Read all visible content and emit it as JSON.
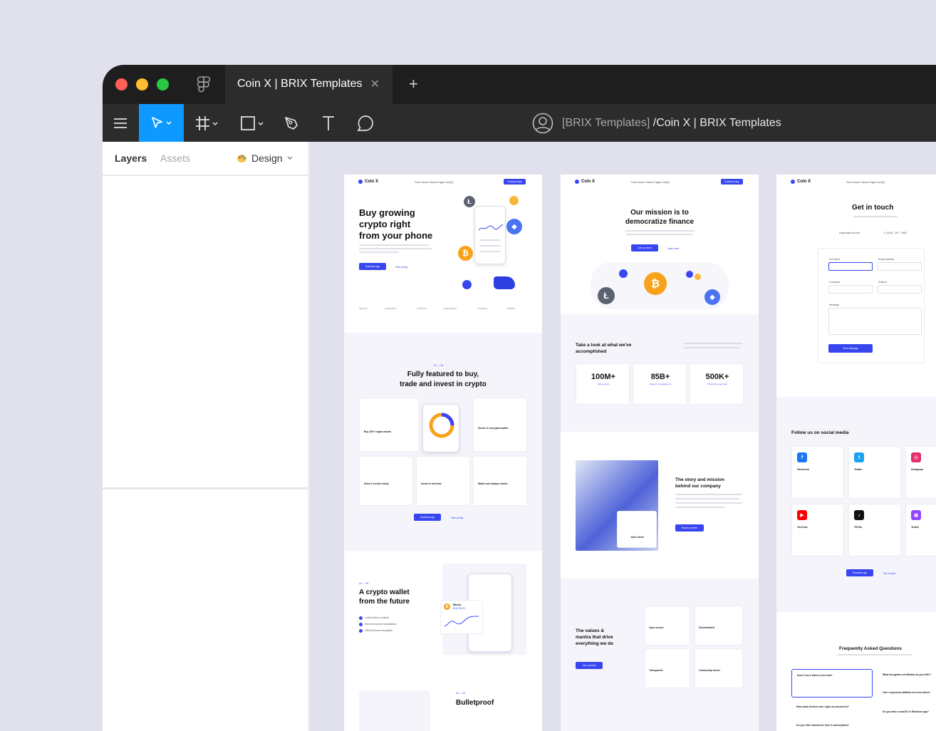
{
  "window": {
    "tab_title": "Coin X | BRIX Templates",
    "tab_close": "✕",
    "new_tab": "+",
    "breadcrumb_team": "[BRIX Templates]",
    "breadcrumb_file": " /Coin X | BRIX Templates"
  },
  "toolbar": {
    "tools": [
      "menu-icon",
      "move-tool-icon",
      "frame-tool-icon",
      "shape-tool-icon",
      "pen-tool-icon",
      "text-tool-icon",
      "comment-tool-icon"
    ]
  },
  "panel": {
    "tab_layers": "Layers",
    "tab_assets": "Assets",
    "tab_design": "Design"
  },
  "colors": {
    "accent": "#0d99ff",
    "brand": "#3846f0",
    "titlebar": "#1e1e1e",
    "toolbar": "#2c2c2c",
    "canvas": "#e1e1ee"
  },
  "frame_home": {
    "logo": "Coin X",
    "nav": "Home   About   Tokens   Pages   Cart(3)",
    "nav_button": "Download app",
    "hero_title_1": "Buy growing",
    "hero_title_2": "crypto right",
    "hero_title_3": "from your phone",
    "hero_primary": "Download app",
    "hero_secondary": "View pricing",
    "logos": [
      "agency",
      "application",
      "business",
      "organization",
      "company",
      "institute"
    ],
    "features_kicker": "01 — 03",
    "features_title_1": "Fully featured to buy,",
    "features_title_2": "trade and invest in crypto",
    "features": [
      "Buy 100+ crypto assets",
      "Secure & encrypted wallet",
      "Send & receive easily",
      "Invest in real time",
      "Watch and analyze charts"
    ],
    "features_primary": "Download app",
    "features_secondary": "View pricing",
    "wallet_kicker": "02 — 03",
    "wallet_title_1": "A crypto wallet",
    "wallet_title_2": "from the future",
    "wallet_checks": [
      "Lowest fees in market",
      "Fast and secure transactions",
      "256-bit secure encryption"
    ],
    "wallet_coin": "Bitcoin",
    "wallet_price": "$18,795.22",
    "bullet_kicker": "03 — 03",
    "bullet_title": "Bulletproof"
  },
  "frame_about": {
    "logo": "Coin X",
    "nav": "Home   About   Tokens   Pages   Cart(3)",
    "nav_button": "Download app",
    "mission_1": "Our mission is to",
    "mission_2": "democratize finance",
    "mission_primary": "Join our team",
    "mission_secondary": "Learn more",
    "accomplished_1": "Take a look at what we've",
    "accomplished_2": "accomplished",
    "stats": [
      {
        "num": "100M+",
        "label": "Active users"
      },
      {
        "num": "85B+",
        "label": "Assets in management"
      },
      {
        "num": "500K+",
        "label": "Payments every day"
      }
    ],
    "story_1": "The story and mission",
    "story_2": "behind our company",
    "story_button": "Browse careers",
    "quote_name": "John Carter",
    "values_1": "The values &",
    "values_2": "mantra that drive",
    "values_3": "everything we do",
    "values_button": "Join our team",
    "values": [
      "Open source",
      "Decentralized",
      "Transparent",
      "Community driven"
    ]
  },
  "frame_contact": {
    "logo": "Coin X",
    "nav": "Home   About   Tokens   Pages   Cart(3)",
    "title": "Get in touch",
    "email": "support@coin.com",
    "phone": "+1 (324) - 367 - 9950",
    "label_name": "Full name",
    "label_email": "Email address",
    "label_company": "Company",
    "label_subject": "Subject",
    "label_message": "Message",
    "submit": "Send message",
    "social_title": "Follow us on social media",
    "socials": [
      "Facebook",
      "Twitter",
      "Instagram",
      "YouTube",
      "TikTok",
      "Twitch"
    ],
    "social_primary": "Download app",
    "social_secondary": "Get in touch",
    "faq_title": "Frequently Asked Questions",
    "faqs": [
      "Does Coin X offers a free trial?",
      "What encryption certificates do you offer?",
      "Can I request an addition of a new token?",
      "How many devices can I login my account to?",
      "Do you have a macOS or Windows app?",
      "Do you offer refunds for Coin X subscription?"
    ]
  }
}
